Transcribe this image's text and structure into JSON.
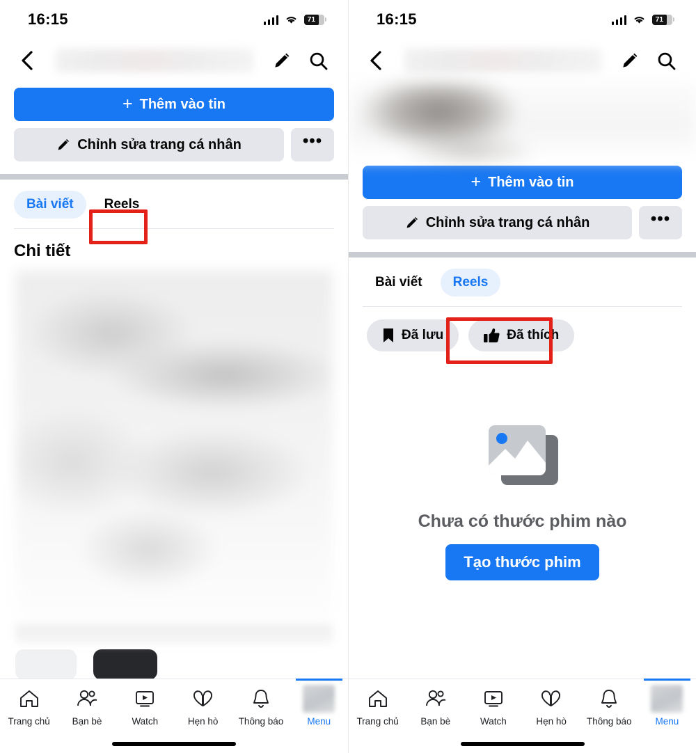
{
  "status_bar": {
    "time": "16:15",
    "battery_percent": "71",
    "signal_icon": "cellular-signal-icon",
    "wifi_icon": "wifi-icon",
    "battery_icon": "battery-icon"
  },
  "header": {
    "back_icon": "back-chevron-icon",
    "title_redacted": "",
    "edit_icon": "pencil-icon",
    "search_icon": "search-icon"
  },
  "actions": {
    "add_story_label": "Thêm vào tin",
    "add_story_plus": "+",
    "edit_profile_label": "Chỉnh sửa trang cá nhân",
    "edit_profile_icon": "pencil-icon",
    "more_label": "•••"
  },
  "tabs": {
    "posts_label": "Bài viết",
    "reels_label": "Reels"
  },
  "left_screen": {
    "active_tab": "Bài viết",
    "section_title": "Chi tiết",
    "highlight_target": "Reels"
  },
  "right_screen": {
    "active_tab": "Reels",
    "highlight_target": "Đã thích",
    "filters": [
      {
        "label": "Đã lưu",
        "icon": "bookmark-icon",
        "highlighted": false
      },
      {
        "label": "Đã thích",
        "icon": "thumbs-up-icon",
        "highlighted": true
      }
    ],
    "empty_state": {
      "icon": "photo-stack-placeholder-icon",
      "title": "Chưa có thước phim nào",
      "button_label": "Tạo thước phim"
    }
  },
  "bottom_nav": {
    "items": [
      {
        "label": "Trang chủ",
        "icon": "home-icon",
        "active": false
      },
      {
        "label": "Bạn bè",
        "icon": "friends-icon",
        "active": false
      },
      {
        "label": "Watch",
        "icon": "watch-play-icon",
        "active": false
      },
      {
        "label": "Hẹn hò",
        "icon": "dating-hearts-icon",
        "active": false
      },
      {
        "label": "Thông báo",
        "icon": "bell-icon",
        "active": false
      },
      {
        "label": "Menu",
        "icon": "avatar-menu-icon",
        "active": true
      }
    ]
  },
  "colors": {
    "primary_blue": "#1877f2",
    "pill_blue_bg": "#e7f0fd",
    "button_gray": "#e4e6eb",
    "highlight_red": "#e32119",
    "divider_gray": "#c9ccd1"
  }
}
